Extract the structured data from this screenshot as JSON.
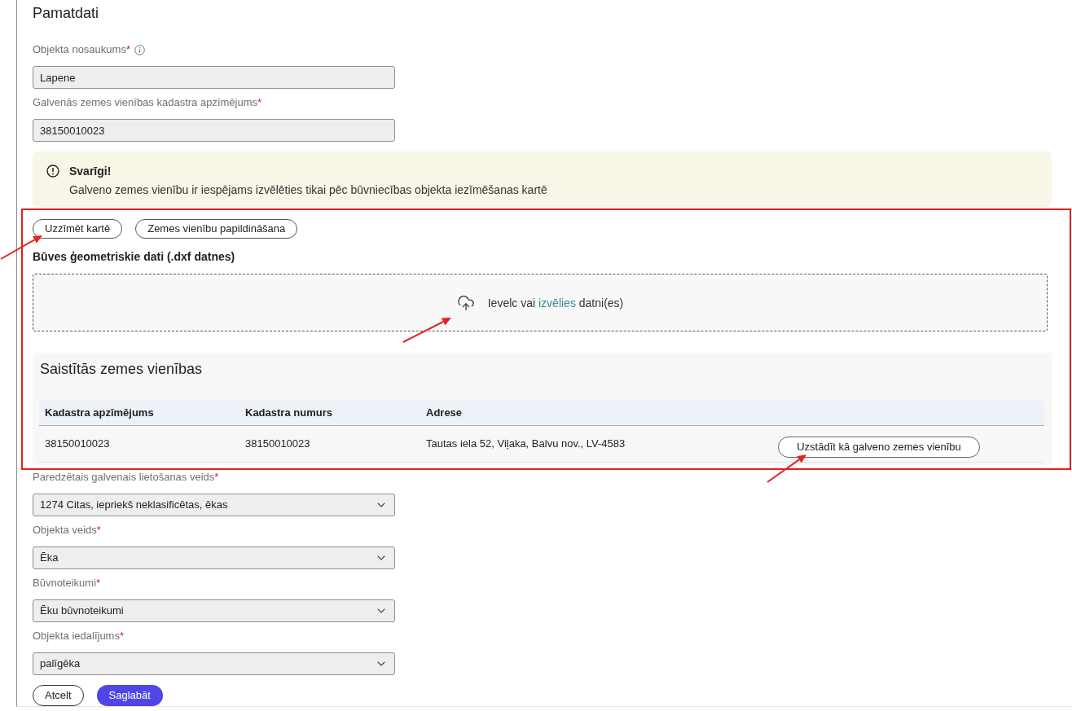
{
  "section_title": "Pamatdati",
  "top_fields": [
    {
      "kind": "text",
      "label": "Objekta nosaukums",
      "required_mark": "*",
      "info": true,
      "value": "Lapene"
    },
    {
      "kind": "text",
      "label": "Galvenās zemes vienības kadastra apzīmējums",
      "required_mark": "*",
      "info": false,
      "value": "38150010023"
    }
  ],
  "notice": {
    "title": "Svarīgi!",
    "text": "Galveno zemes vienību ir iespējams izvēlēties tikai pēc būvniecības objekta iezīmēšanas kartē"
  },
  "map_buttons": [
    "Uzzīmēt kartē",
    "Zemes vienību papildināšana"
  ],
  "geometry": {
    "title": "Būves ģeometriskie dati (.dxf datnes)",
    "dropzone": {
      "before": "Ievelc vai",
      "link": "izvēlies",
      "after": "datni(es)"
    }
  },
  "linked_units": {
    "title": "Saistītās zemes vienības",
    "columns": [
      "Kadastra apzīmējums",
      "Kadastra numurs",
      "Adrese"
    ],
    "rows": [
      {
        "cells": [
          "38150010023",
          "38150010023",
          "Tautas iela 52, Viļaka, Balvu nov., LV-4583"
        ],
        "action": "Uzstādīt kā galveno zemes vienību"
      }
    ]
  },
  "bottom_fields": [
    {
      "kind": "select",
      "label": "Paredzētais galvenais lietošanas veids",
      "required_mark": "*",
      "info": false,
      "value": "1274 Citas, iepriekš neklasificētas, ēkas"
    },
    {
      "kind": "select",
      "label": "Objekta veids",
      "required_mark": "*",
      "info": false,
      "value": "Ēka"
    },
    {
      "kind": "select",
      "label": "Būvnoteikumi",
      "required_mark": "*",
      "info": false,
      "value": "Ēku būvnoteikumi"
    },
    {
      "kind": "select",
      "label": "Objekta iedalījums",
      "required_mark": "*",
      "info": false,
      "value": "palīgēka"
    }
  ],
  "actions": [
    {
      "kind": "secondary",
      "label": "Atcelt"
    },
    {
      "kind": "primary",
      "label": "Saglabāt"
    }
  ]
}
